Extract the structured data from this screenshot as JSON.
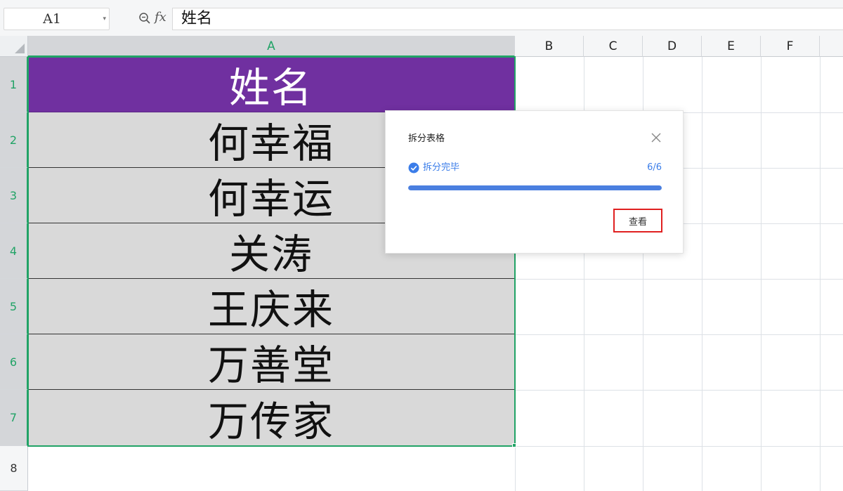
{
  "formula_bar": {
    "cell_reference": "A1",
    "formula_value": "姓名",
    "fx_label": "fx"
  },
  "icons": {
    "zoom": "zoom-icon",
    "dropdown": "chevron-down-icon",
    "close": "close-icon",
    "check": "check-circle-icon"
  },
  "columns": [
    {
      "label": "A",
      "selected": true
    },
    {
      "label": "B",
      "selected": false
    },
    {
      "label": "C",
      "selected": false
    },
    {
      "label": "D",
      "selected": false
    },
    {
      "label": "E",
      "selected": false
    },
    {
      "label": "F",
      "selected": false
    }
  ],
  "rows": [
    {
      "label": "1",
      "selected": true
    },
    {
      "label": "2",
      "selected": true
    },
    {
      "label": "3",
      "selected": true
    },
    {
      "label": "4",
      "selected": true
    },
    {
      "label": "5",
      "selected": true
    },
    {
      "label": "6",
      "selected": true
    },
    {
      "label": "7",
      "selected": true
    },
    {
      "label": "8",
      "selected": false
    }
  ],
  "cells": {
    "A1": "姓名",
    "A2": "何幸福",
    "A3": "何幸运",
    "A4": "关涛",
    "A5": "王庆来",
    "A6": "万善堂",
    "A7": "万传家"
  },
  "colors": {
    "header_fill": "#7030a0",
    "body_fill": "#d9d9d9",
    "selection": "#21a366",
    "accent": "#3b7de9",
    "highlight_border": "#e02020"
  },
  "dialog": {
    "title": "拆分表格",
    "status_text": "拆分完毕",
    "progress_text": "6/6",
    "progress_fraction": 1.0,
    "view_button_label": "查看"
  }
}
